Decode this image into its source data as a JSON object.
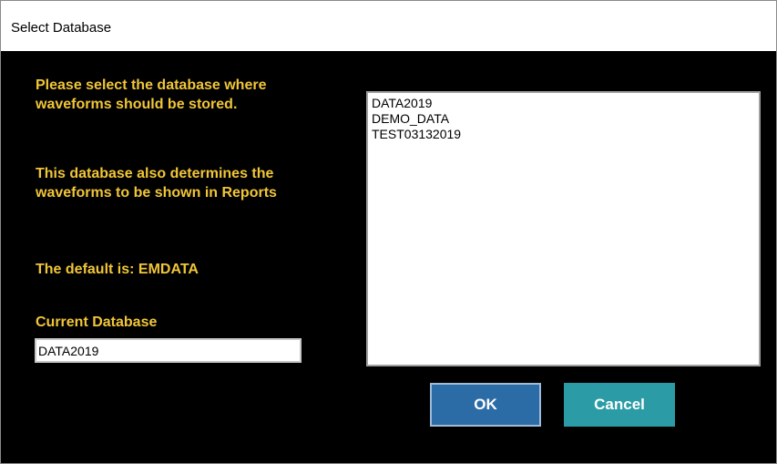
{
  "window": {
    "title": "Select Database"
  },
  "dialog": {
    "message_1": "Please select the database where waveforms should be stored.",
    "message_2": "This database also determines the waveforms to be shown in Reports",
    "message_3": "The default is:  EMDATA",
    "current_label": "Current Database",
    "current_value": "DATA2019"
  },
  "database_list": {
    "items": [
      "DATA2019",
      "DEMO_DATA",
      "TEST03132019"
    ]
  },
  "buttons": {
    "ok_label": "OK",
    "cancel_label": "Cancel"
  },
  "colors": {
    "background": "#000000",
    "label_text": "#f1c638",
    "ok_button": "#2c6ca6",
    "cancel_button": "#2b9ca6"
  }
}
